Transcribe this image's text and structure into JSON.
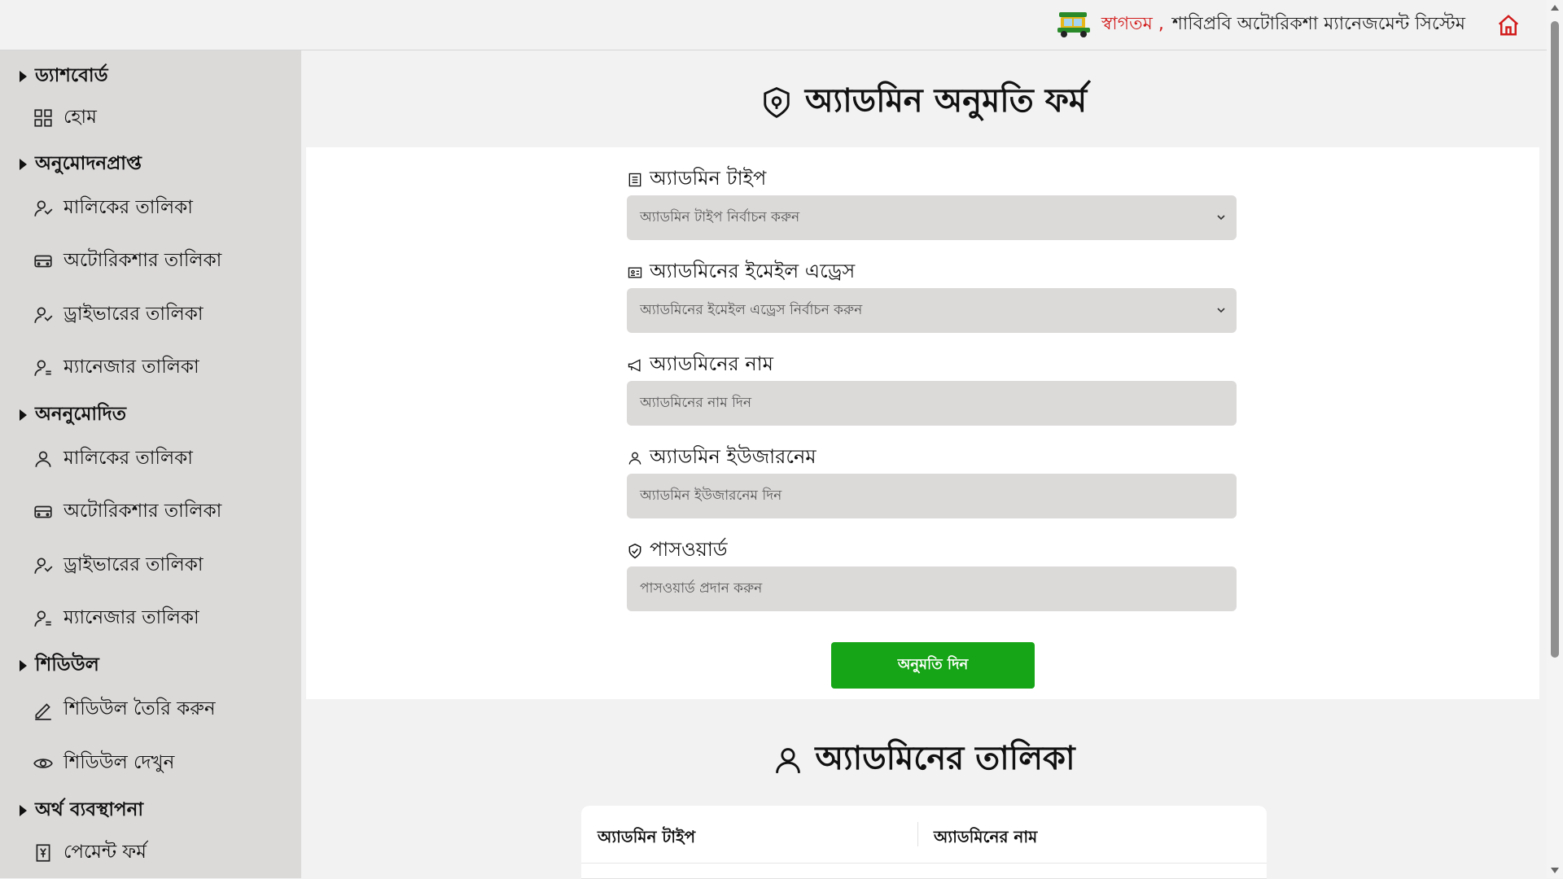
{
  "header": {
    "welcome": "স্বাগতম ,",
    "system_name": "শাবিপ্রবি অটোরিকশা ম্যানেজমেন্ট সিস্টেম",
    "icons": [
      "rickshaw-logo",
      "home-icon"
    ],
    "accent_color": "#d21b1b"
  },
  "sidebar": {
    "sections": [
      {
        "title": "ড্যাশবোর্ড",
        "items": [
          {
            "label": "হোম",
            "icon": "grid-icon"
          }
        ]
      },
      {
        "title": "অনুমোদনপ্রাপ্ত",
        "items": [
          {
            "label": "মালিকের তালিকা",
            "icon": "users-icon"
          },
          {
            "label": "অটোরিকশার তালিকা",
            "icon": "vehicle-icon"
          },
          {
            "label": "ড্রাইভারের তালিকা",
            "icon": "users-icon"
          },
          {
            "label": "ম্যানেজার তালিকা",
            "icon": "user-settings-icon"
          }
        ]
      },
      {
        "title": "অননুমোদিত",
        "items": [
          {
            "label": "মালিকের তালিকা",
            "icon": "user-icon"
          },
          {
            "label": "অটোরিকশার তালিকা",
            "icon": "vehicle-icon"
          },
          {
            "label": "ড্রাইভারের তালিকা",
            "icon": "users-icon"
          },
          {
            "label": "ম্যানেজার তালিকা",
            "icon": "user-settings-icon"
          }
        ]
      },
      {
        "title": "শিডিউল",
        "items": [
          {
            "label": "শিডিউল তৈরি করুন",
            "icon": "pencil-icon"
          },
          {
            "label": "শিডিউল দেখুন",
            "icon": "eye-icon"
          }
        ]
      },
      {
        "title": "অর্থ ব্যবস্থাপনা",
        "items": [
          {
            "label": "পেমেন্ট ফর্ম",
            "icon": "yen-receipt-icon"
          }
        ]
      }
    ]
  },
  "form": {
    "title": "অ্যাডমিন অনুমতি ফর্ম",
    "fields": [
      {
        "label": "অ্যাডমিন টাইপ",
        "placeholder": "অ্যাডমিন টাইপ নির্বাচন করুন",
        "kind": "select"
      },
      {
        "label": "অ্যাডমিনের ইমেইল এড্রেস",
        "placeholder": "অ্যাডমিনের ইমেইল এড্রেস নির্বাচন করুন",
        "kind": "select"
      },
      {
        "label": "অ্যাডমিনের নাম",
        "placeholder": "অ্যাডমিনের নাম দিন",
        "kind": "text"
      },
      {
        "label": "অ্যাডমিন ইউজারনেম",
        "placeholder": "অ্যাডমিন ইউজারনেম দিন",
        "kind": "text"
      },
      {
        "label": "পাসওয়ার্ড",
        "placeholder": "পাসওয়ার্ড প্রদান করুন",
        "kind": "password"
      }
    ],
    "submit_label": "অনুমতি দিন",
    "submit_color": "#16a516"
  },
  "admin_list": {
    "title": "অ্যাডমিনের তালিকা",
    "columns": [
      "অ্যাডমিন টাইপ",
      "অ্যাডমিনের নাম"
    ]
  }
}
